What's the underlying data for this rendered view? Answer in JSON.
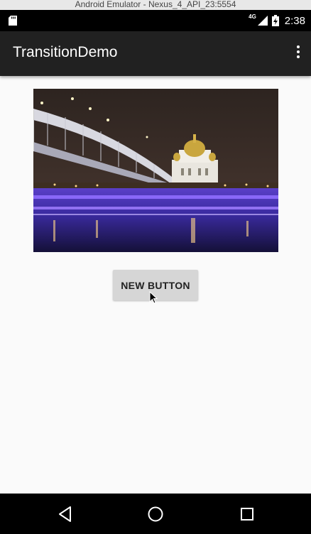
{
  "window": {
    "title": "Android Emulator - Nexus_4_API_23:5554"
  },
  "status_bar": {
    "network": "4G",
    "time": "2:38"
  },
  "app_bar": {
    "title": "TransitionDemo",
    "menu_icon": "overflow-menu-icon"
  },
  "content": {
    "image_icon": "cathedral-bridge-night-photo",
    "button_label": "NEW BUTTON"
  },
  "nav_bar": {
    "back_icon": "back-icon",
    "home_icon": "home-icon",
    "recents_icon": "recents-icon"
  },
  "colors": {
    "app_bar": "#212121",
    "status_bar": "#000000",
    "background": "#fafafa",
    "button": "#d6d6d6"
  }
}
